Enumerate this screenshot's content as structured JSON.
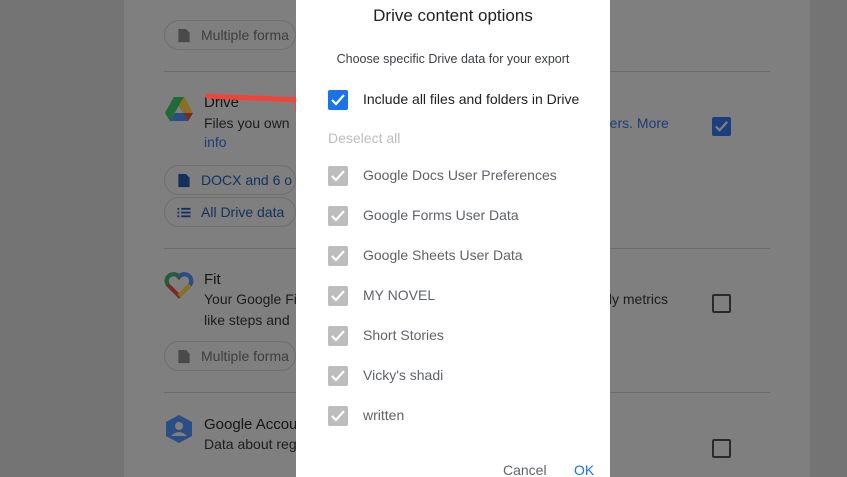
{
  "background": {
    "photos_chip": "Multiple forma",
    "drive": {
      "title": "Drive",
      "desc_line1": "Files you own",
      "desc_line2": "info",
      "desc_right": "uters. More",
      "chip_format": "DOCX and 6 o",
      "chip_data": "All Drive data"
    },
    "fit": {
      "title": "Fit",
      "desc_line1": "Your Google Fi",
      "desc_line2": "like steps and",
      "desc_right": "aily metrics",
      "chip_format": "Multiple forma"
    },
    "account": {
      "title": "Google Accou",
      "desc_line1": "Data about reg"
    }
  },
  "dialog": {
    "title": "Drive content options",
    "subtitle": "Choose specific Drive data for your export",
    "include_all_label": "Include all files and folders in Drive",
    "deselect_all": "Deselect all",
    "items": [
      {
        "label": "Google Docs User Preferences"
      },
      {
        "label": "Google Forms User Data"
      },
      {
        "label": "Google Sheets User Data"
      },
      {
        "label": "MY NOVEL"
      },
      {
        "label": "Short Stories"
      },
      {
        "label": "Vicky's shadi"
      },
      {
        "label": "written"
      }
    ],
    "cancel_label": "Cancel",
    "ok_label": "OK"
  },
  "colors": {
    "accent": "#1a73e8",
    "arrow": "#f04438",
    "disabled_checkbox": "#bdbdbd"
  }
}
